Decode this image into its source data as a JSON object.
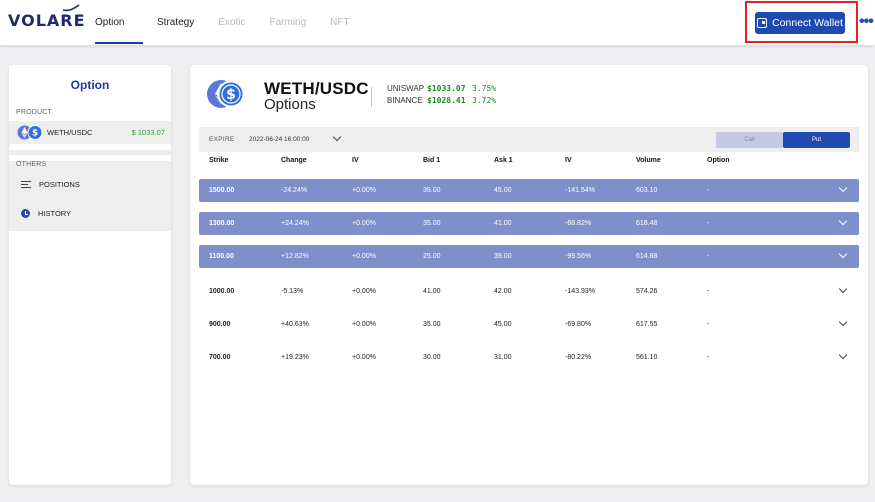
{
  "header": {
    "logo": "VOLARE",
    "tabs": [
      {
        "label": "Option",
        "active": true,
        "enabled": true
      },
      {
        "label": "Strategy",
        "active": false,
        "enabled": true
      },
      {
        "label": "Exotic",
        "active": false,
        "enabled": false
      },
      {
        "label": "Farming",
        "active": false,
        "enabled": false
      },
      {
        "label": "NFT",
        "active": false,
        "enabled": false
      }
    ],
    "connect_label": "Connect Wallet",
    "more_label": "•••"
  },
  "sidebar": {
    "title": "Option",
    "product_label": "PRODUCT",
    "pair_name": "WETH/USDC",
    "pair_price": "$ 1033.07",
    "others_label": "OTHERS",
    "items": [
      {
        "label": "POSITIONS",
        "icon": "list-icon"
      },
      {
        "label": "HISTORY",
        "icon": "clock-icon"
      }
    ]
  },
  "main": {
    "pair_title": "WETH/USDC",
    "pair_subtitle": "Options",
    "quotes": [
      {
        "exchange": "UNISWAP",
        "price": "$1033.07",
        "change": "3.75%"
      },
      {
        "exchange": "BINANCE",
        "price": "$1028.41",
        "change": "3.72%"
      }
    ],
    "expire_label": "EXPIRE",
    "expire_value": "2022-06-24 16:00:00",
    "toggle": {
      "call": "Call",
      "put": "Put",
      "selected": "Put"
    },
    "columns": [
      "Strike",
      "Change",
      "IV",
      "Bid 1",
      "Ask 1",
      "IV",
      "Volume",
      "Option"
    ],
    "rows": [
      {
        "strike": "1500.00",
        "change": "-24.24%",
        "iv": "+0.00%",
        "bid": "39.00",
        "ask": "45.00",
        "iv2": "-141.54%",
        "volume": "603.10",
        "option": "-",
        "highlight": true
      },
      {
        "strike": "1300.00",
        "change": "+24.24%",
        "iv": "+0.00%",
        "bid": "35.00",
        "ask": "41.00",
        "iv2": "-68.82%",
        "volume": "618.48",
        "option": "-",
        "highlight": true
      },
      {
        "strike": "1100.00",
        "change": "+12.82%",
        "iv": "+0.00%",
        "bid": "25.00",
        "ask": "39.00",
        "iv2": "-99.56%",
        "volume": "614.88",
        "option": "-",
        "highlight": true
      },
      {
        "strike": "1000.00",
        "change": "-5.13%",
        "iv": "+0.00%",
        "bid": "41.00",
        "ask": "42.00",
        "iv2": "-143.93%",
        "volume": "574.26",
        "option": "-",
        "highlight": false
      },
      {
        "strike": "900.00",
        "change": "+40.63%",
        "iv": "+0.00%",
        "bid": "35.00",
        "ask": "45.00",
        "iv2": "-69.80%",
        "volume": "617.55",
        "option": "-",
        "highlight": false
      },
      {
        "strike": "700.00",
        "change": "+19.23%",
        "iv": "+0.00%",
        "bid": "30.00",
        "ask": "31.00",
        "iv2": "-80.22%",
        "volume": "561.10",
        "option": "-",
        "highlight": false
      }
    ]
  },
  "colors": {
    "accent": "#1f4ab0",
    "highlight_row": "#7f8fcb",
    "positive": "#2e9c2e",
    "annotation_box": "#e5221f"
  }
}
